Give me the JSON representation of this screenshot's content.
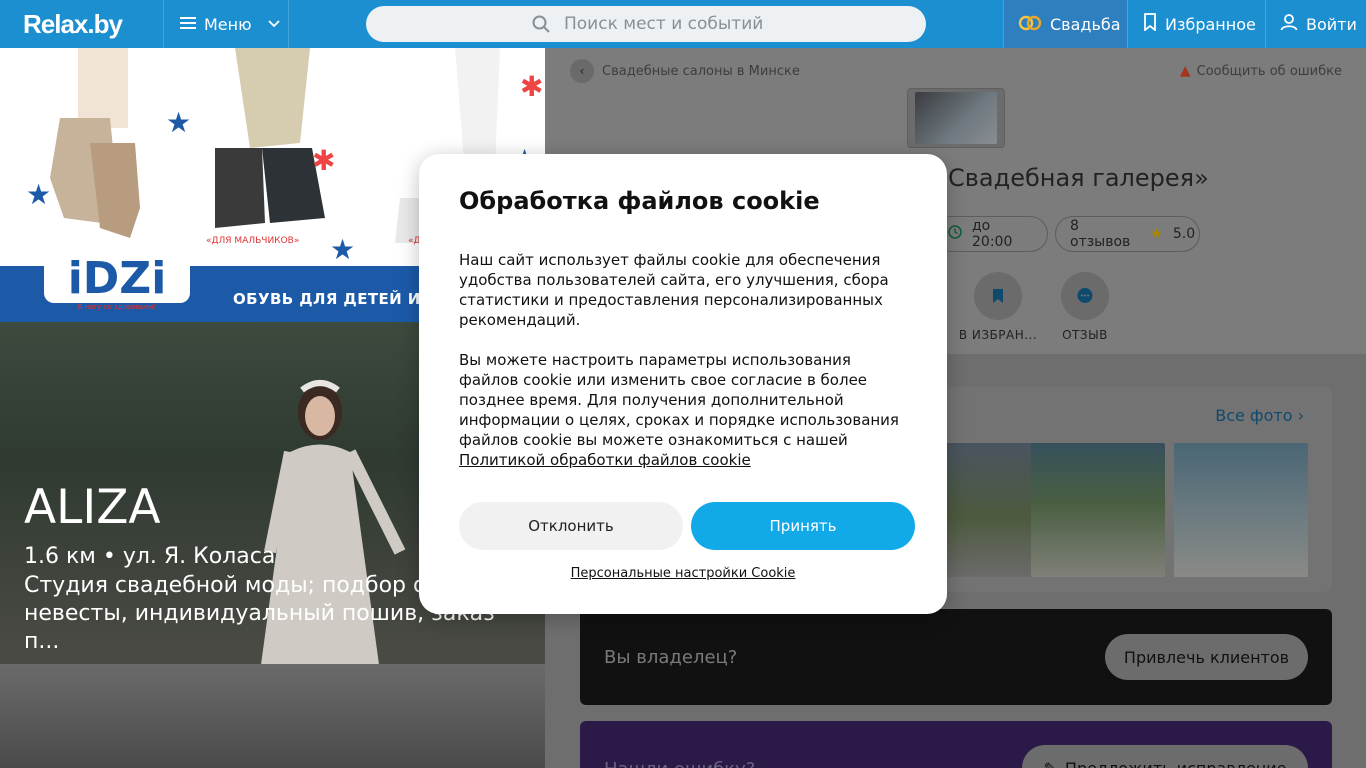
{
  "header": {
    "logo": "Relax.by",
    "menu_label": "Меню",
    "search_placeholder": "Поиск мест и событий",
    "wedding_label": "Свадьба",
    "favorites_label": "Избранное",
    "login_label": "Войти",
    "bg_color": "#1b8fd0"
  },
  "ad": {
    "text": "ОБУВЬ ДЛЯ ДЕТЕЙ И П",
    "brand": "iDZi",
    "tag_boys": "«ДЛЯ МАЛЬЧИКОВ»",
    "tag_other": "«Д",
    "slogan": "В ногу со здоровьем!"
  },
  "promo": {
    "title": "ALIZA",
    "subtitle": "1.6 км • ул. Я. Коласа",
    "description": "Студия свадебной моды; подбор об... невесты, индивидуальный пошив, заказ п..."
  },
  "page": {
    "breadcrumb": "Свадебные салоны в Минске",
    "report_label": "Сообщить об ошибке",
    "venue_title": "Свадебная галерея»",
    "hours": "до 20:00",
    "reviews": "8 отзывов",
    "rating": "5.0",
    "action_save": "В ИЗБРАН...",
    "action_review": "ОТЗЫВ",
    "all_photos": "Все фото",
    "owner_question": "Вы владелец?",
    "owner_button": "Привлечь клиентов",
    "error_question": "Нашли ошибку?",
    "error_button": "Предложить исправление"
  },
  "cookie": {
    "title": "Обработка файлов cookie",
    "p1": "Наш сайт использует файлы cookie для обеспечения удобства пользователей сайта, его улучшения, сбора статистики и предоставления персонализированных рекомендаций.",
    "p2": "Вы можете настроить параметры использования файлов cookie или изменить свое согласие в более позднее время. Для получения дополнительной информации о целях, сроках и порядке использования файлов cookie вы можете ознакомиться с нашей",
    "policy_link": "Политикой обработки файлов cookie",
    "decline": "Отклонить",
    "accept": "Принять",
    "personal_settings": "Персональные настройки Cookie",
    "accept_color": "#12a9e8"
  }
}
